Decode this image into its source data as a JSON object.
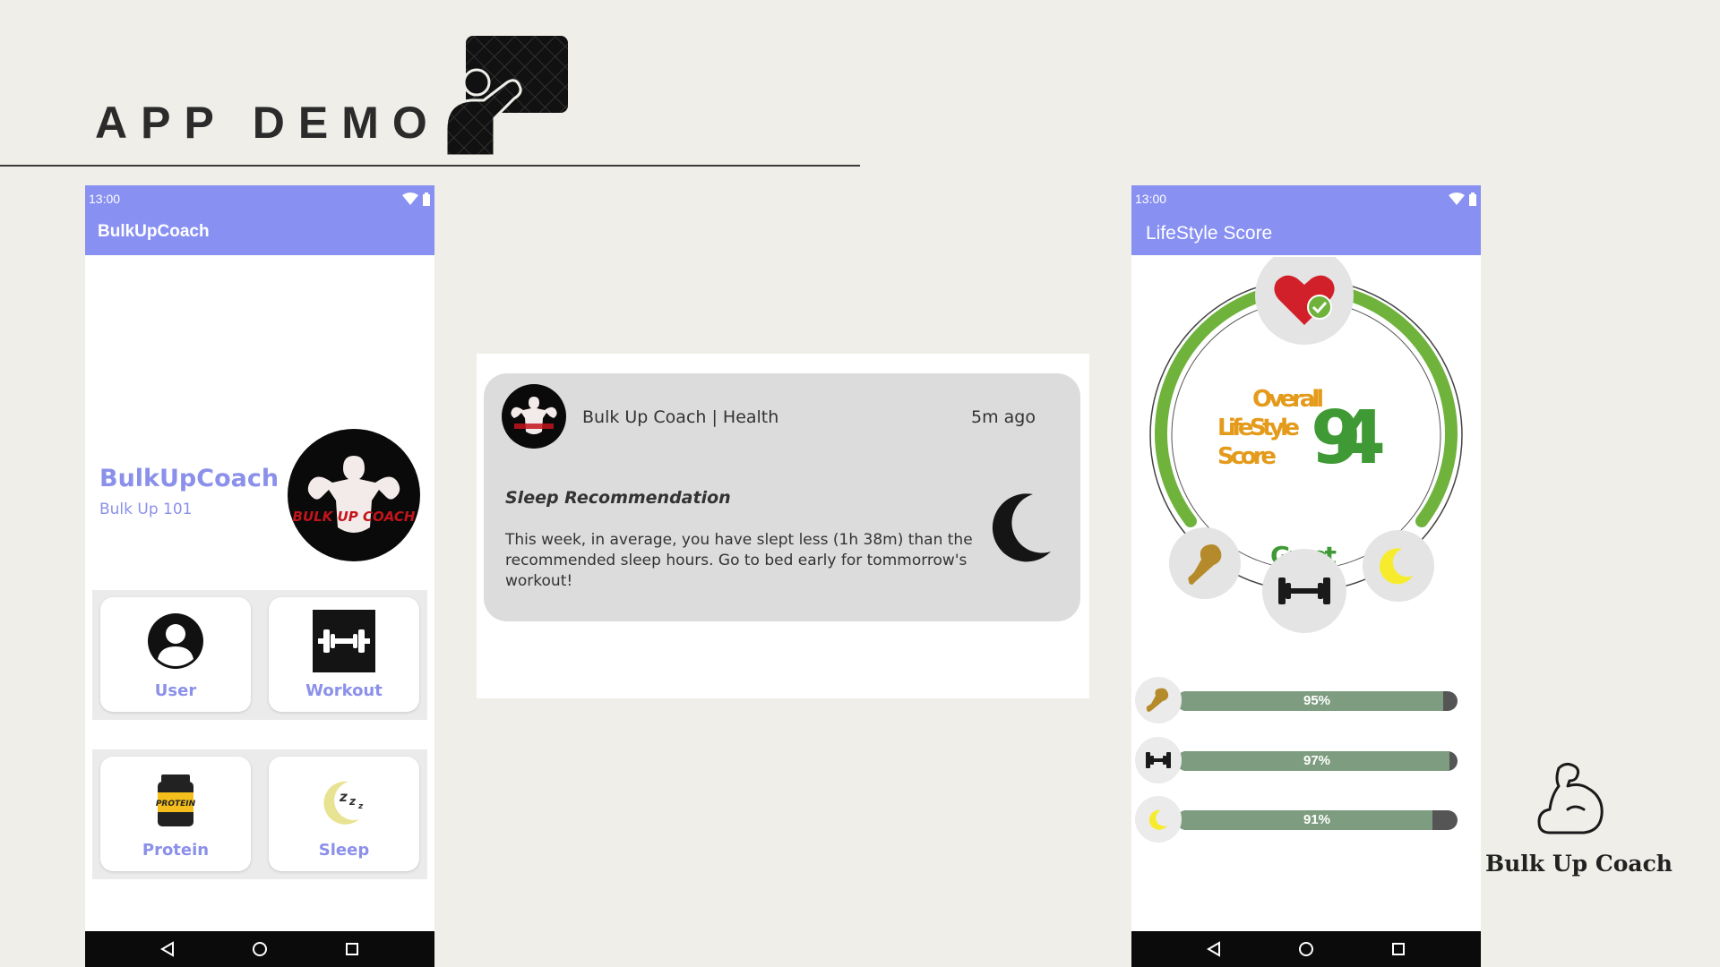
{
  "slide": {
    "title": "APP DEMO"
  },
  "home_screen": {
    "status_time": "13:00",
    "app_bar_title": "BulkUpCoach",
    "brand_name": "BulkUpCoach",
    "brand_sub": "Bulk Up 101",
    "logo_text": "BULK UP COACH",
    "tiles": [
      {
        "label": "User",
        "icon": "user-icon"
      },
      {
        "label": "Workout",
        "icon": "dumbbell-icon"
      },
      {
        "label": "Protein",
        "icon": "protein-jar-icon",
        "icon_text": "PROTEIN"
      },
      {
        "label": "Sleep",
        "icon": "sleep-moon-icon"
      }
    ]
  },
  "notification": {
    "app_name": "Bulk Up Coach | Health",
    "time_ago": "5m ago",
    "title": "Sleep Recommendation",
    "body": "This week, in average, you have slept less (1h 38m) than the recommended sleep hours. Go to bed early for tommorrow's workout!"
  },
  "score_screen": {
    "status_time": "13:00",
    "app_bar_title": "LifeStyle Score",
    "gauge_label_line1": "Overall",
    "gauge_label_line2": "LifeStyle",
    "gauge_label_line3": "Score",
    "score_value": "94",
    "score_rating": "Great",
    "bars": [
      {
        "icon": "drumstick-icon",
        "percent": 95,
        "label": "95%"
      },
      {
        "icon": "dumbbell-icon",
        "percent": 97,
        "label": "97%"
      },
      {
        "icon": "moon-icon",
        "percent": 91,
        "label": "91%"
      }
    ]
  },
  "brand_corner": {
    "name": "Bulk Up Coach"
  },
  "colors": {
    "app_bar": "#8890f2",
    "accent_text": "#8b90ea",
    "gauge_green": "#6fb33c",
    "score_green": "#3f9a35",
    "gauge_label_orange": "#e49a1a",
    "bar_fill": "#7e9d80",
    "bar_track": "#555555",
    "background": "#efeee9"
  }
}
